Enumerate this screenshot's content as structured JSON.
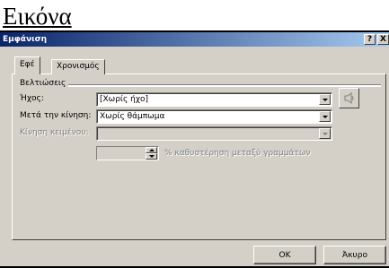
{
  "heading": "Εικόνα",
  "dialog": {
    "title": "Εμφάνιση",
    "help_button": "?",
    "close_button": "X"
  },
  "tabs": [
    {
      "label": "Εφέ",
      "active": true
    },
    {
      "label": "Χρονισμός",
      "active": false
    }
  ],
  "enhancements": {
    "group_title": "Βελτιώσεις",
    "sound_label": "Ήχος:",
    "sound_value": "[Χωρίς ήχο]",
    "after_animation_label": "Μετά την κίνηση:",
    "after_animation_value": "Χωρίς θάμπωμα",
    "animate_text_label": "Κίνηση κειμένου:",
    "animate_text_value": "",
    "delay_value": "",
    "delay_note": "% καθυστέρηση μεταξύ γραμμάτων"
  },
  "buttons": {
    "ok": "OK",
    "cancel": "Άκυρο"
  }
}
